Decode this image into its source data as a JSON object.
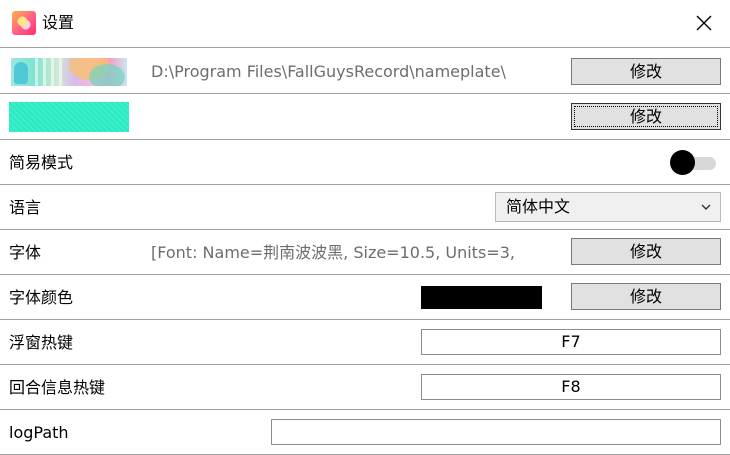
{
  "window": {
    "title": "设置",
    "app_icon": "app-logo-icon",
    "close_icon": "close-icon"
  },
  "rows": {
    "nameplate": {
      "path": "D:\\Program Files\\FallGuysRecord\\nameplate\\",
      "button_label": "修改"
    },
    "color": {
      "swatch_color": "#33ecc6",
      "button_label": "修改"
    },
    "simple_mode": {
      "label": "简易模式",
      "toggle_on": false
    },
    "language": {
      "label": "语言",
      "selected": "简体中文"
    },
    "font": {
      "label": "字体",
      "value": "[Font: Name=荆南波波黑, Size=10.5, Units=3,",
      "button_label": "修改"
    },
    "font_color": {
      "label": "字体颜色",
      "swatch_color": "#000000",
      "button_label": "修改"
    },
    "float_hotkey": {
      "label": "浮窗热键",
      "value": "F7"
    },
    "round_hotkey": {
      "label": "回合信息热键",
      "value": "F8"
    },
    "log_path": {
      "label": "logPath",
      "value": ""
    }
  }
}
